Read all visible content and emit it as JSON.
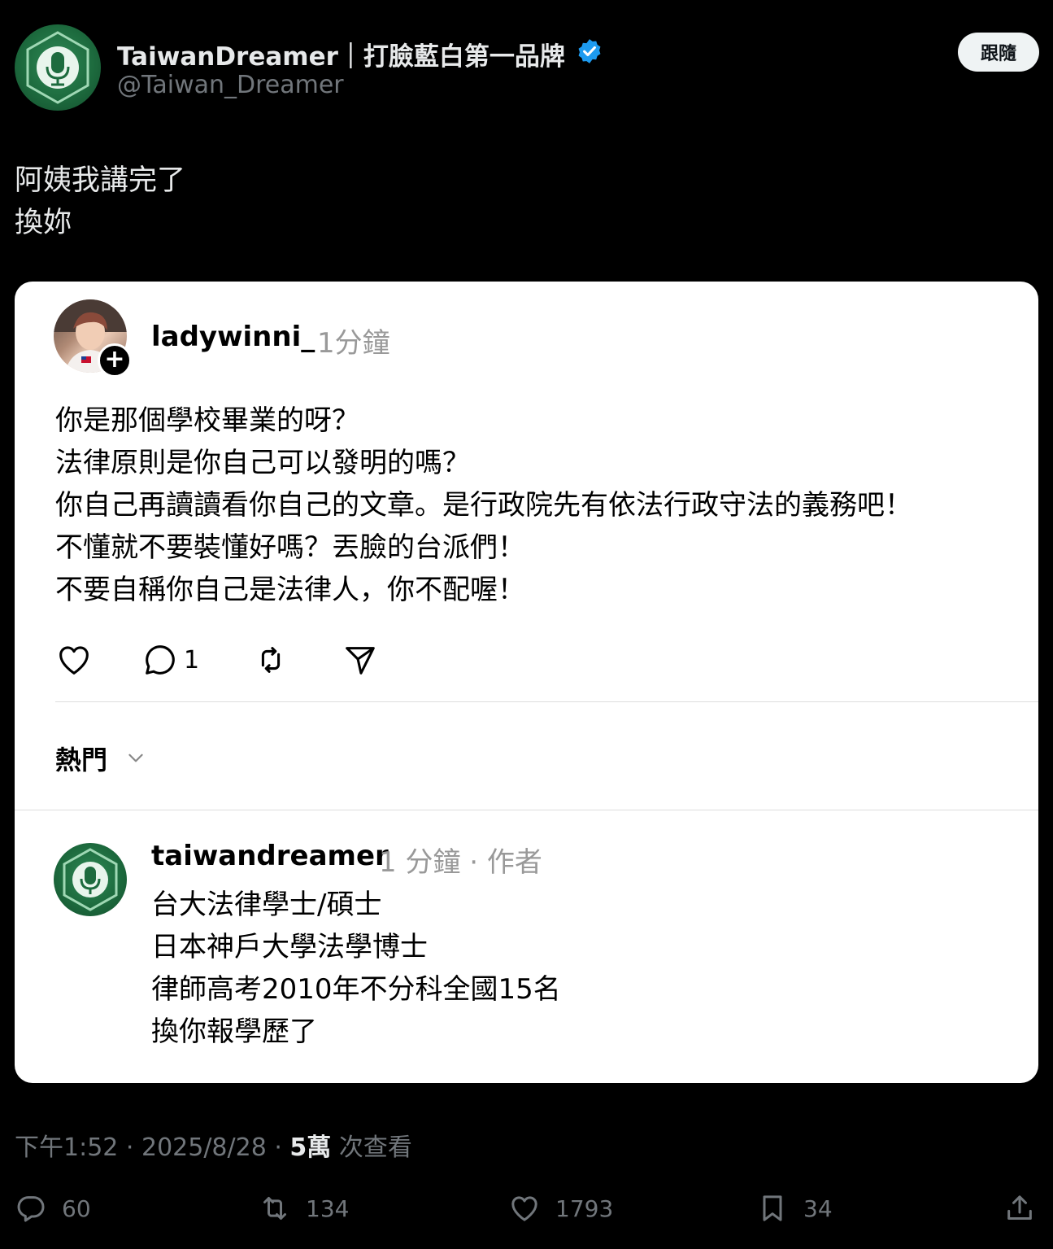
{
  "post": {
    "author_name": "TaiwanDreamer｜打臉藍白第一品牌",
    "author_handle": "@Taiwan_Dreamer",
    "follow_label": "跟隨",
    "text_line1": "阿姨我講完了",
    "text_line2": "換妳"
  },
  "quoted": {
    "username": "ladywinni_",
    "time": "1分鐘",
    "lines": [
      "你是那個學校畢業的呀？",
      "法律原則是你自己可以發明的嗎？",
      "你自己再讀讀看你自己的文章。是行政院先有依法行政守法的義務吧！",
      "不懂就不要裝懂好嗎？丟臉的台派們！",
      "不要自稱你自己是法律人，你不配喔！"
    ],
    "comment_count": "1",
    "sort_label": "熱門",
    "reply": {
      "username": "taiwandreamer",
      "meta": "1 分鐘 · 作者",
      "lines": [
        "台大法律學士/碩士",
        "日本神戶大學法學博士",
        "律師高考2010年不分科全國15名",
        "換你報學歷了"
      ]
    }
  },
  "meta": {
    "time_date": "下午1:52 · 2025/8/28 · ",
    "views_count": "5萬",
    "views_label": " 次查看"
  },
  "stats": {
    "replies": "60",
    "reposts": "134",
    "likes": "1793",
    "bookmarks": "34"
  },
  "icons": {
    "verified": "verified-badge-icon",
    "reply": "reply-icon",
    "repost": "repost-icon",
    "like": "heart-icon",
    "bookmark": "bookmark-icon",
    "share": "share-icon"
  },
  "colors": {
    "background": "#000000",
    "card": "#ffffff",
    "verified": "#1d9bf0",
    "muted": "#71767b",
    "brand_green": "#1d6b3e"
  }
}
